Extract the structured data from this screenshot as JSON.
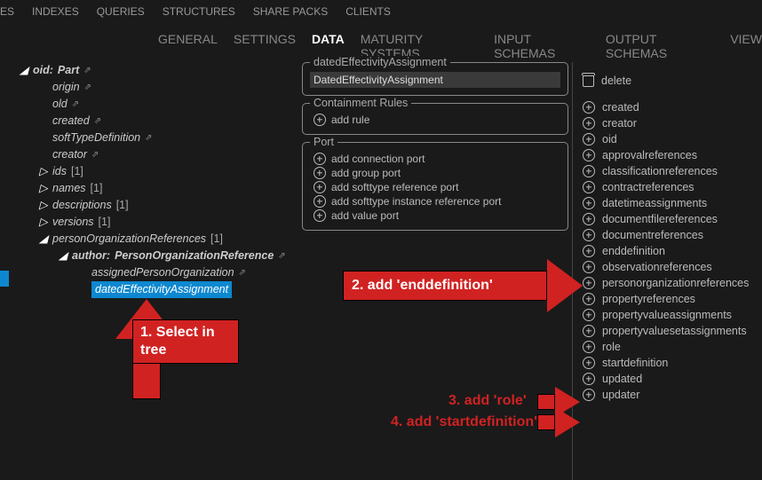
{
  "top_menu": [
    "ES",
    "INDEXES",
    "QUERIES",
    "STRUCTURES",
    "SHARE PACKS",
    "CLIENTS"
  ],
  "tabs": [
    "GENERAL",
    "SETTINGS",
    "DATA",
    "MATURITY SYSTEMS",
    "INPUT SCHEMAS",
    "OUTPUT SCHEMAS",
    "VIEW"
  ],
  "active_tab": "DATA",
  "tree": {
    "oid_label": "oid:",
    "oid_type": "Part",
    "children": {
      "origin": "origin",
      "old": "old",
      "created": "created",
      "softTypeDefinition": "softTypeDefinition",
      "creator": "creator"
    },
    "lists": [
      {
        "name": "ids",
        "count": "[1]"
      },
      {
        "name": "names",
        "count": "[1]"
      },
      {
        "name": "descriptions",
        "count": "[1]"
      },
      {
        "name": "versions",
        "count": "[1]"
      },
      {
        "name": "personOrganizationReferences",
        "count": "[1]"
      }
    ],
    "author_label": "author:",
    "author_type": "PersonOrganizationReference",
    "assigned": "assignedPersonOrganization",
    "selected": "datedEffectivityAssignment"
  },
  "group1": {
    "title": "datedEffectivityAssignment",
    "item": "DatedEffectivityAssignment"
  },
  "group2": {
    "title": "Containment Rules",
    "item": "add rule"
  },
  "group3": {
    "title": "Port",
    "items": [
      "add connection port",
      "add group port",
      "add softtype reference port",
      "add softtype instance reference port",
      "add value port"
    ]
  },
  "right": {
    "delete": "delete",
    "items": [
      "created",
      "creator",
      "oid",
      "approvalreferences",
      "classificationreferences",
      "contractreferences",
      "datetimeassignments",
      "documentfilereferences",
      "documentreferences",
      "enddefinition",
      "observationreferences",
      "personorganizationreferences",
      "propertyreferences",
      "propertyvalueassignments",
      "propertyvaluesetassignments",
      "role",
      "startdefinition",
      "updated",
      "updater"
    ]
  },
  "annotations": {
    "a1": "1. Select in tree",
    "a2": "2. add 'enddefinition'",
    "a3": "3. add 'role'",
    "a4": "4. add 'startdefinition'"
  }
}
